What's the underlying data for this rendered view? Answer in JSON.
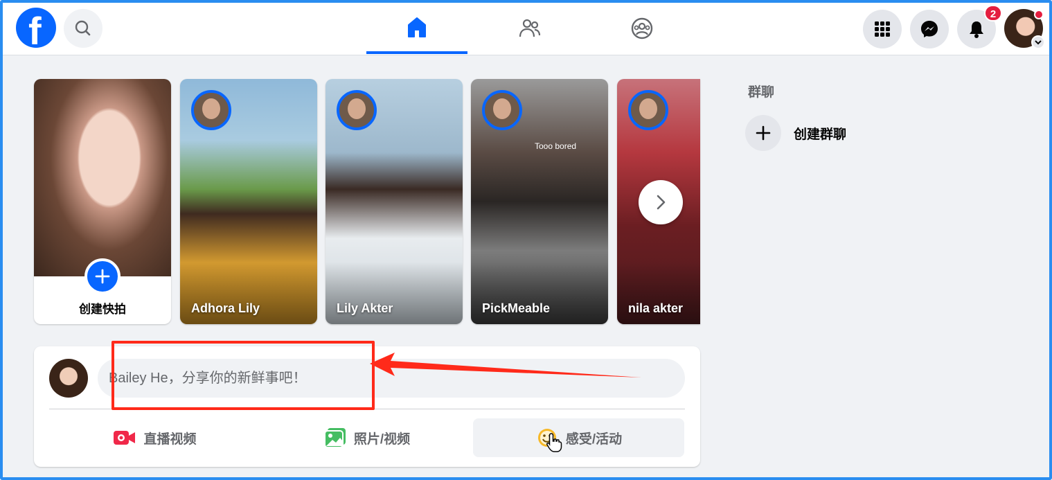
{
  "nav": {
    "logo_letter": "f",
    "notifications_badge": "2"
  },
  "stories": {
    "create_label": "创建快拍",
    "items": [
      {
        "name": "Adhora Lily"
      },
      {
        "name": "Lily Akter"
      },
      {
        "name": "PickMeable",
        "caption": "Tooo bored"
      },
      {
        "name": "nila akter"
      }
    ]
  },
  "composer": {
    "placeholder": "Bailey He，分享你的新鲜事吧！",
    "actions": {
      "live": "直播视频",
      "photo": "照片/视频",
      "feeling": "感受/活动"
    }
  },
  "sidebar_right": {
    "title": "群聊",
    "create_group": "创建群聊"
  },
  "colors": {
    "brand": "#0866ff",
    "annotation": "#ff2a1a",
    "frame": "#2a8df0",
    "badge": "#e41e3f"
  }
}
